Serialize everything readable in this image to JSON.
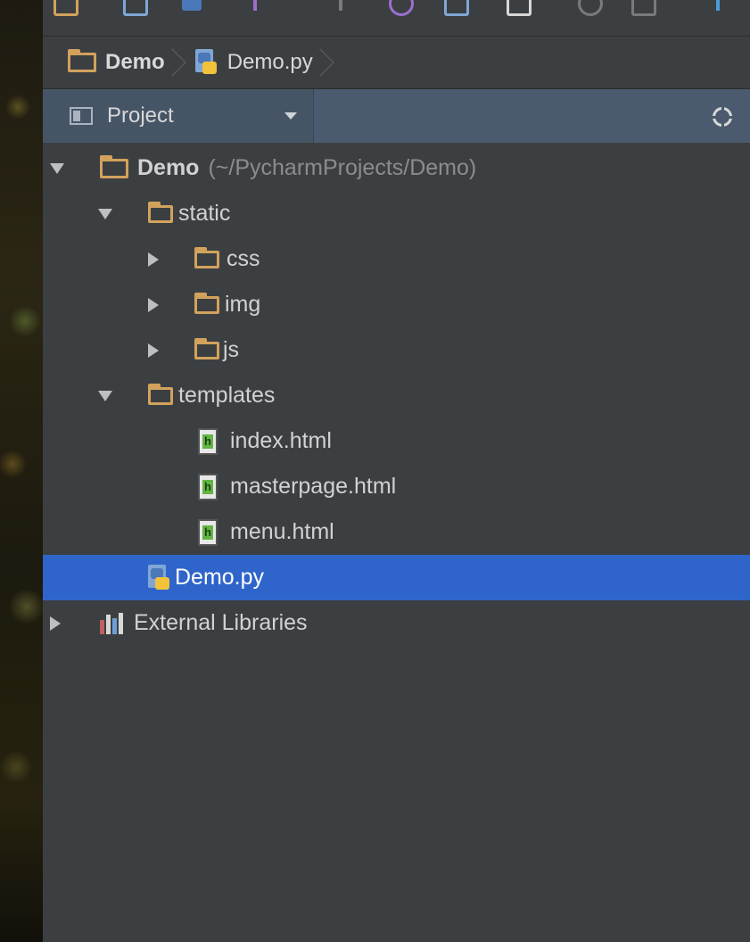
{
  "breadcrumb": {
    "items": [
      {
        "label": "Demo",
        "icon": "folder-icon"
      },
      {
        "label": "Demo.py",
        "icon": "python-file-icon"
      }
    ]
  },
  "project_panel": {
    "view_label": "Project",
    "locate_icon": "crosshair-icon"
  },
  "tree": {
    "root_label": "Demo",
    "root_path": "(~/PycharmProjects/Demo)",
    "static_label": "static",
    "css_label": "css",
    "img_label": "img",
    "js_label": "js",
    "templates_label": "templates",
    "index_label": "index.html",
    "masterpage_label": "masterpage.html",
    "menu_label": "menu.html",
    "demopy_label": "Demo.py",
    "external_label": "External Libraries"
  },
  "colors": {
    "selection": "#2f65ca",
    "folder": "#d2a25c",
    "html_icon": "#62b543",
    "panel_bg": "#3c3f41",
    "header_bar": "#4b5a6e"
  }
}
